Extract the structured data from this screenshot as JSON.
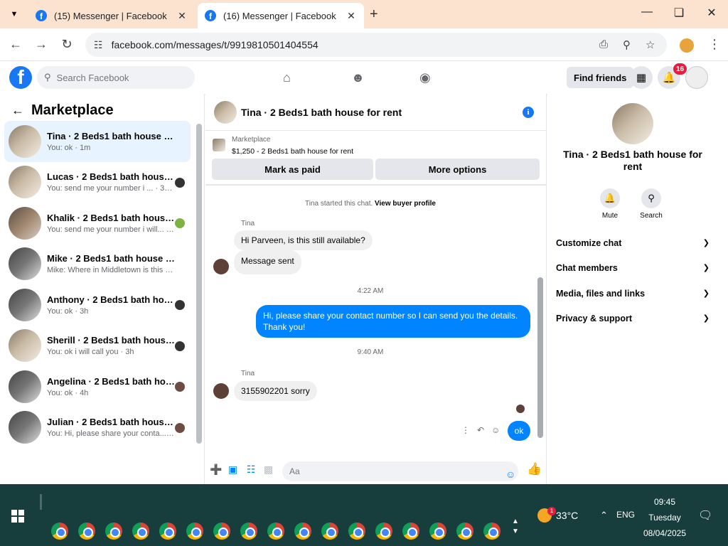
{
  "browser": {
    "tabs": [
      {
        "title": "(15) Messenger | Facebook"
      },
      {
        "title": "(16) Messenger | Facebook"
      }
    ],
    "url": "facebook.com/messages/t/9919810501404554"
  },
  "fb": {
    "search_placeholder": "Search Facebook",
    "find_friends": "Find friends",
    "notif_count": "16"
  },
  "sidebar": {
    "title": "Marketplace",
    "chats": [
      {
        "name": "Tina · 2 Beds1 bath house for rent",
        "snippet": "You: ok · 1m"
      },
      {
        "name": "Lucas · 2 Beds1 bath house fo...",
        "snippet": "You: send me your number i ... · 36m"
      },
      {
        "name": "Khalik · 2 Beds1 bath house f...",
        "snippet": "You: send me your number i will... · 3h"
      },
      {
        "name": "Mike · 2 Beds1 bath house for r...",
        "snippet": "Mike: Where in Middletown is this ... · 3h"
      },
      {
        "name": "Anthony · 2 Beds1 bath hous...",
        "snippet": "You: ok · 3h"
      },
      {
        "name": "Sherill · 2 Beds1 bath house f...",
        "snippet": "You: ok i will call you · 3h"
      },
      {
        "name": "Angelina · 2 Beds1 bath hous...",
        "snippet": "You: ok · 4h"
      },
      {
        "name": "Julian · 2 Beds1 bath house fo...",
        "snippet": "You: Hi, please share your conta... · 5h"
      }
    ]
  },
  "conversation": {
    "title": "Tina · 2 Beds1 bath house for rent",
    "marketplace_label": "Marketplace",
    "listing": "$1,250 - 2 Beds1 bath house for rent",
    "mark_paid": "Mark as paid",
    "more_options": "More options",
    "started_text": "Tina started this chat.",
    "view_profile": "View buyer profile",
    "sender1": "Tina",
    "msg1": "Hi Parveen, is this still available?",
    "msg2": "Message sent",
    "time1": "4:22 AM",
    "msg_mine": "Hi, please share your contact number so I can send you the details. Thank you!",
    "time2": "9:40 AM",
    "sender2": "Tina",
    "msg3": "3155902201 sorry",
    "msg_ok": "ok",
    "composer_placeholder": "Aa"
  },
  "info_panel": {
    "name": "Tina · 2 Beds1 bath house for rent",
    "mute": "Mute",
    "search": "Search",
    "sections": [
      "Customize chat",
      "Chat members",
      "Media, files and links",
      "Privacy & support"
    ]
  },
  "taskbar": {
    "temp": "33°C",
    "weather_badge": "1",
    "lang": "ENG",
    "time": "09:45",
    "day": "Tuesday",
    "date": "08/04/2025"
  }
}
